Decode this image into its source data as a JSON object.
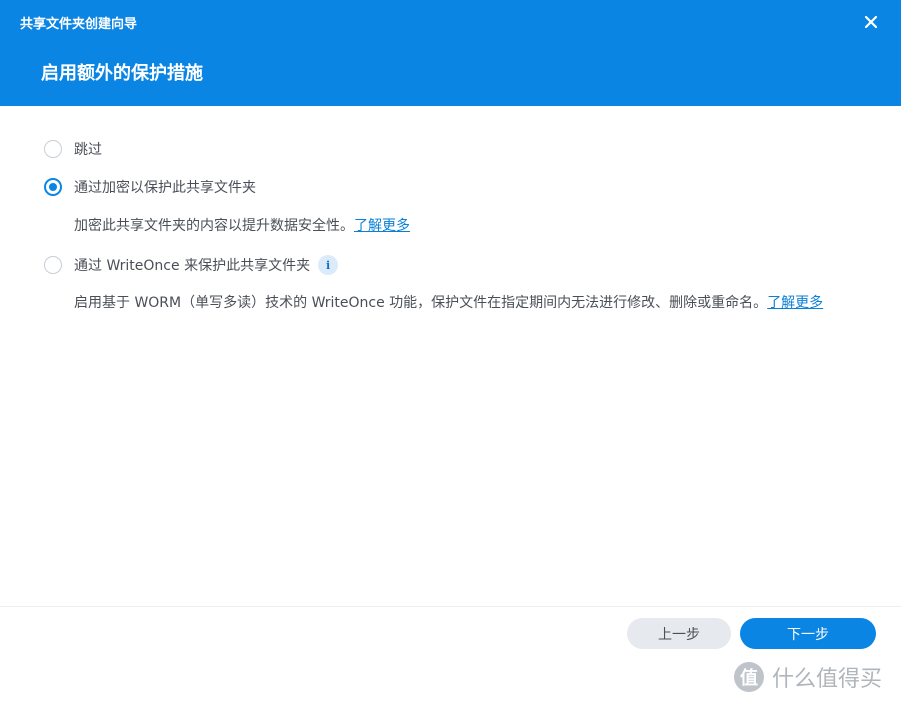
{
  "window": {
    "title": "共享文件夹创建向导"
  },
  "header": {
    "step_title": "启用额外的保护措施"
  },
  "options": [
    {
      "label": "跳过",
      "checked": false
    },
    {
      "label": "通过加密以保护此共享文件夹",
      "checked": true,
      "description": "加密此共享文件夹的内容以提升数据安全性。",
      "link": "了解更多"
    },
    {
      "label": "通过 WriteOnce 来保护此共享文件夹",
      "checked": false,
      "info_icon": "i",
      "description": "启用基于 WORM（单写多读）技术的 WriteOnce 功能，保护文件在指定期间内无法进行修改、删除或重命名。",
      "link": "了解更多"
    }
  ],
  "footer": {
    "prev_label": "上一步",
    "next_label": "下一步"
  },
  "watermark": {
    "logo": "值",
    "text": "什么值得买"
  },
  "colors": {
    "accent": "#0a85e4",
    "link": "#0a7fd6",
    "text": "#4a4f57",
    "secondary_button": "#e6eaee"
  }
}
